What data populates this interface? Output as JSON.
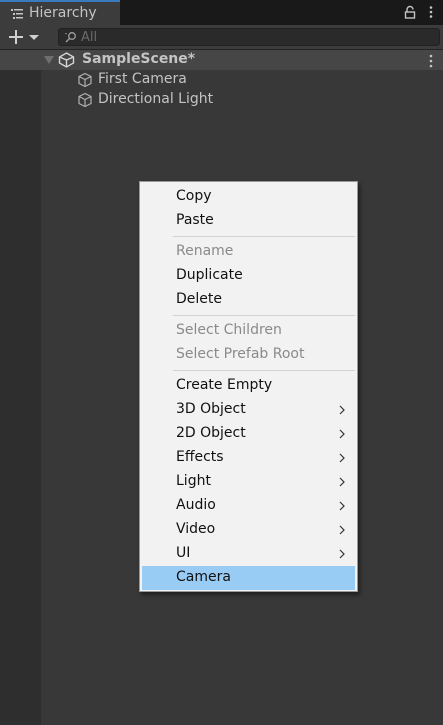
{
  "window": {
    "tab_title": "Hierarchy",
    "tab_icon": "hierarchy-list-icon",
    "lock_icon": "lock-icon",
    "menu_icon": "kebab-menu-icon"
  },
  "toolbar": {
    "add_icon": "plus-icon",
    "dropdown_icon": "dropdown-arrow-icon",
    "search_placeholder": "All",
    "search_icon": "search-icon"
  },
  "hierarchy": {
    "scene": {
      "name": "SampleScene*",
      "icon": "unity-scene-icon",
      "expanded": true
    },
    "objects": [
      {
        "name": "First Camera",
        "icon": "gameobject-cube-icon"
      },
      {
        "name": "Directional Light",
        "icon": "gameobject-cube-icon"
      }
    ]
  },
  "context_menu": {
    "items": [
      {
        "label": "Copy",
        "enabled": true
      },
      {
        "label": "Paste",
        "enabled": true
      },
      {
        "label": "Rename",
        "enabled": false
      },
      {
        "label": "Duplicate",
        "enabled": true
      },
      {
        "label": "Delete",
        "enabled": true
      },
      {
        "label": "Select Children",
        "enabled": false
      },
      {
        "label": "Select Prefab Root",
        "enabled": false
      },
      {
        "label": "Create Empty",
        "enabled": true
      },
      {
        "label": "3D Object",
        "enabled": true,
        "submenu": true
      },
      {
        "label": "2D Object",
        "enabled": true,
        "submenu": true
      },
      {
        "label": "Effects",
        "enabled": true,
        "submenu": true
      },
      {
        "label": "Light",
        "enabled": true,
        "submenu": true
      },
      {
        "label": "Audio",
        "enabled": true,
        "submenu": true
      },
      {
        "label": "Video",
        "enabled": true,
        "submenu": true
      },
      {
        "label": "UI",
        "enabled": true,
        "submenu": true
      },
      {
        "label": "Camera",
        "enabled": true,
        "highlighted": true
      }
    ]
  },
  "colors": {
    "tab_accent": "#3a79bb",
    "menu_highlight": "#99ccf5",
    "panel_bg": "#383838"
  }
}
